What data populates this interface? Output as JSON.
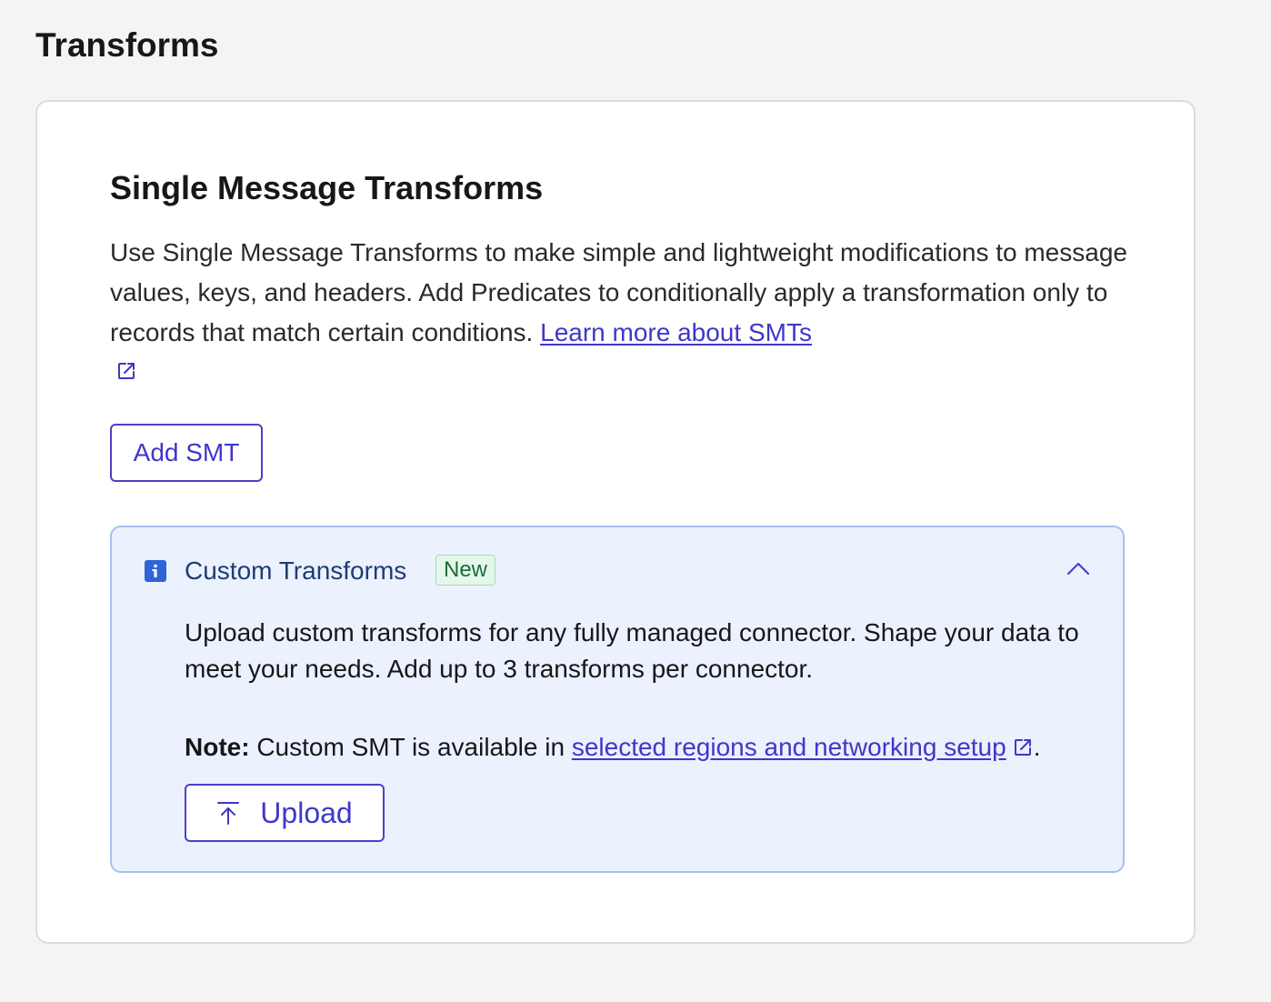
{
  "page": {
    "title": "Transforms"
  },
  "smt": {
    "title": "Single Message Transforms",
    "description": "Use Single Message Transforms to make simple and lightweight modifications to message values, keys, and headers. Add Predicates to conditionally apply a transformation only to records that match certain conditions. ",
    "learn_more_link": "Learn more about SMTs",
    "add_button": "Add SMT"
  },
  "custom": {
    "title": "Custom Transforms",
    "badge": "New",
    "body": "Upload custom transforms for any fully managed connector. Shape your data to meet your needs. Add up to 3 transforms per connector.",
    "note_label": "Note:",
    "note_text": " Custom SMT is available in ",
    "note_link": "selected regions and networking setup",
    "note_end": ".",
    "upload_button": "Upload"
  },
  "icons": {
    "external_link": "external-link-icon",
    "info": "info-icon",
    "collapse": "chevron-up-icon",
    "upload": "upload-icon"
  },
  "colors": {
    "accent": "#3f37c9",
    "info_bg": "#ebf1fd",
    "info_border": "#a8c1ee",
    "badge_bg": "#e4f7ea",
    "badge_text": "#1f6b3a",
    "info_title": "#1f3c74"
  }
}
